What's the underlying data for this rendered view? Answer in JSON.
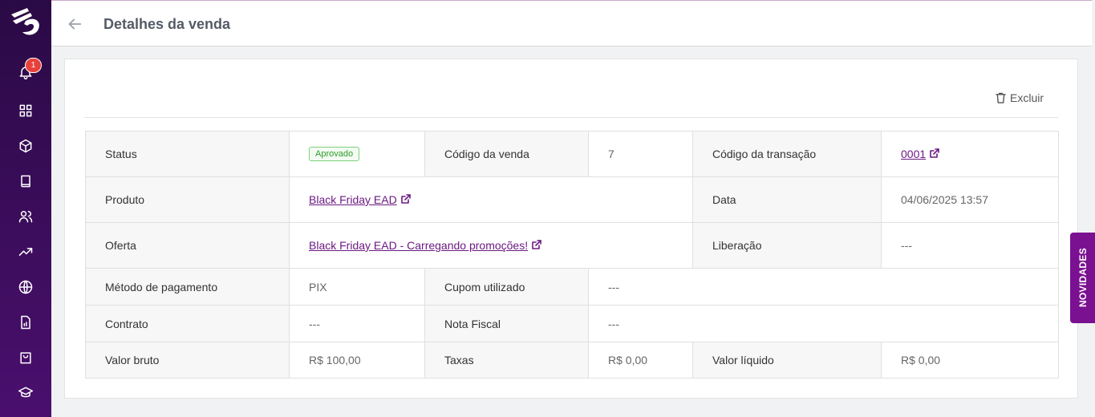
{
  "sidebar": {
    "notification_count": "1",
    "items": [
      {
        "name": "bell-icon"
      },
      {
        "name": "grid-icon"
      },
      {
        "name": "cube-icon"
      },
      {
        "name": "book-icon"
      },
      {
        "name": "users-icon"
      },
      {
        "name": "trending-icon"
      },
      {
        "name": "globe-icon"
      },
      {
        "name": "report-icon"
      },
      {
        "name": "bag-icon"
      },
      {
        "name": "graduation-icon"
      }
    ]
  },
  "header": {
    "title": "Detalhes da venda"
  },
  "actions": {
    "delete_label": "Excluir"
  },
  "details": {
    "status_label": "Status",
    "status_value": "Aprovado",
    "sale_code_label": "Código da venda",
    "sale_code_value": "7",
    "transaction_code_label": "Código da transação",
    "transaction_code_value": "0001",
    "product_label": "Produto",
    "product_value": "Black Friday EAD",
    "date_label": "Data",
    "date_value": "04/06/2025 13:57",
    "offer_label": "Oferta",
    "offer_value": "Black Friday EAD - Carregando promoções!",
    "release_label": "Liberação",
    "release_value": "---",
    "payment_method_label": "Método de pagamento",
    "payment_method_value": "PIX",
    "coupon_label": "Cupom utilizado",
    "coupon_value": "---",
    "contract_label": "Contrato",
    "contract_value": "---",
    "invoice_label": "Nota Fiscal",
    "invoice_value": "---",
    "gross_label": "Valor bruto",
    "gross_value": "R$ 100,00",
    "fees_label": "Taxas",
    "fees_value": "R$ 0,00",
    "net_label": "Valor líquido",
    "net_value": "R$ 0,00"
  },
  "news_tab": {
    "label": "NOVIDADES"
  },
  "colors": {
    "accent": "#6b1a82",
    "sidebar": "#3a0b5a",
    "approved": "#2e9c2b",
    "badge": "#e8413b"
  }
}
